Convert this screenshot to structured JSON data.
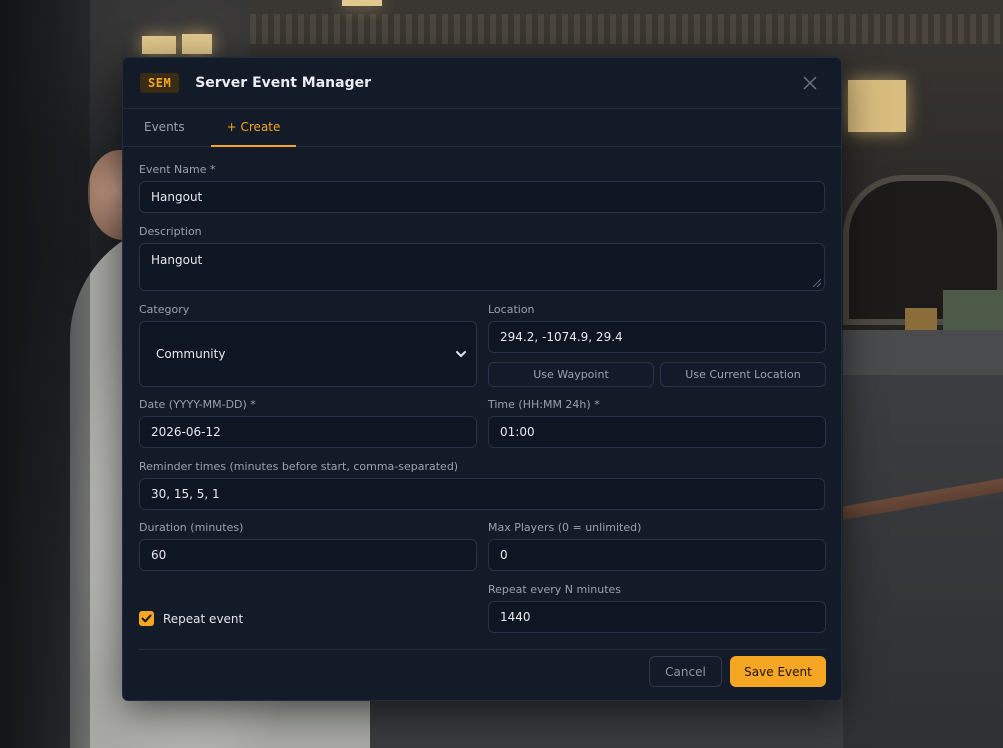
{
  "header": {
    "badge": "SEM",
    "title": "Server Event Manager",
    "close_icon": "close-icon"
  },
  "tabs": [
    {
      "label": "Events",
      "active": false
    },
    {
      "label": "+ Create",
      "active": true
    }
  ],
  "form": {
    "event_name": {
      "label": "Event Name *",
      "value": "Hangout"
    },
    "description": {
      "label": "Description",
      "value": "Hangout"
    },
    "category": {
      "label": "Category",
      "value": "Community"
    },
    "location": {
      "label": "Location",
      "value": "294.2, -1074.9, 29.4",
      "use_waypoint": "Use Waypoint",
      "use_current": "Use Current Location"
    },
    "date": {
      "label": "Date (YYYY-MM-DD) *",
      "value": "2026-06-12"
    },
    "time": {
      "label": "Time (HH:MM 24h) *",
      "value": "01:00"
    },
    "reminders": {
      "label": "Reminder times (minutes before start, comma-separated)",
      "value": "30, 15, 5, 1"
    },
    "duration": {
      "label": "Duration (minutes)",
      "value": "60"
    },
    "max_players": {
      "label": "Max Players (0 = unlimited)",
      "value": "0"
    },
    "repeat": {
      "label": "Repeat event",
      "checked": true
    },
    "repeat_every": {
      "label": "Repeat every N minutes",
      "value": "1440"
    }
  },
  "footer": {
    "cancel": "Cancel",
    "save": "Save Event"
  },
  "colors": {
    "accent": "#f5a623",
    "panel": "#131a28",
    "field": "#0e1523"
  }
}
